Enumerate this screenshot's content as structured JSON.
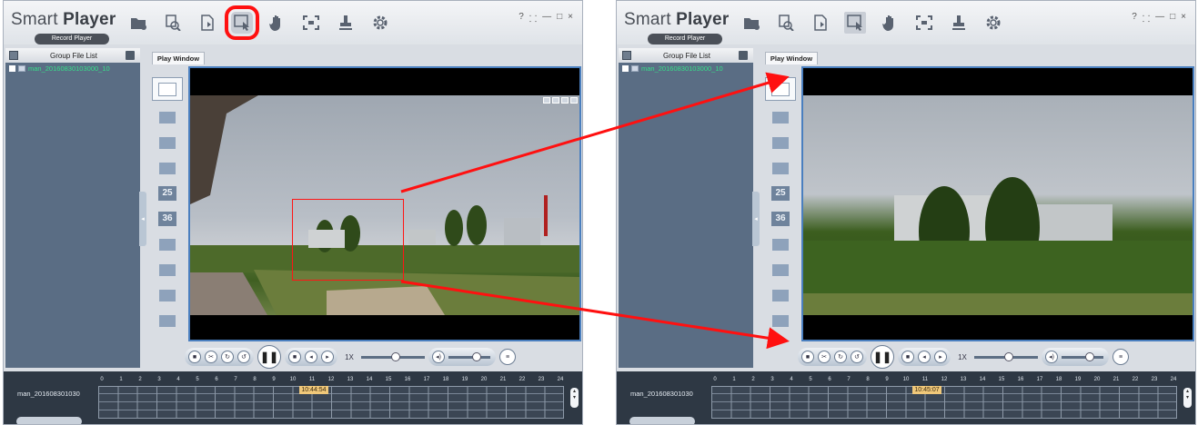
{
  "app": {
    "title_light": "Smart",
    "title_bold": "Player",
    "subtitle": "Record Player"
  },
  "window_controls": [
    "?",
    "⸬",
    "—",
    "□",
    "×"
  ],
  "toolbar_icons": [
    "open-folder-icon",
    "search-file-icon",
    "export-file-icon",
    "zoom-region-icon",
    "hand-icon",
    "fullscreen-icon",
    "stamp-icon",
    "settings-gear-icon"
  ],
  "file_panel": {
    "header": "Group File List",
    "files": [
      "man_20160830103000_10"
    ]
  },
  "tab": {
    "label": "Play Window"
  },
  "layouts": [
    "1",
    "4",
    "9",
    "16",
    "25",
    "36",
    "1+5",
    "1+7",
    "1+9",
    "1+12"
  ],
  "playback": {
    "speed": "1X"
  },
  "timeline": {
    "file_label": "man_201608301030",
    "hours": [
      "0",
      "1",
      "2",
      "3",
      "4",
      "5",
      "6",
      "7",
      "8",
      "9",
      "10",
      "11",
      "12",
      "13",
      "14",
      "15",
      "16",
      "17",
      "18",
      "19",
      "20",
      "21",
      "22",
      "23",
      "24"
    ]
  },
  "panels": [
    {
      "side": "left",
      "current_time": "10:44:54",
      "time_fraction": 0.4479,
      "zoom_mode_highlighted": true
    },
    {
      "side": "right",
      "current_time": "10:45:07",
      "time_fraction": 0.448,
      "zoom_mode_highlighted": false
    }
  ],
  "colors": {
    "highlight": "#ff1010",
    "file_text": "#37e08a",
    "video_border": "#4a7fbf",
    "time_marker": "#f0c87a"
  }
}
